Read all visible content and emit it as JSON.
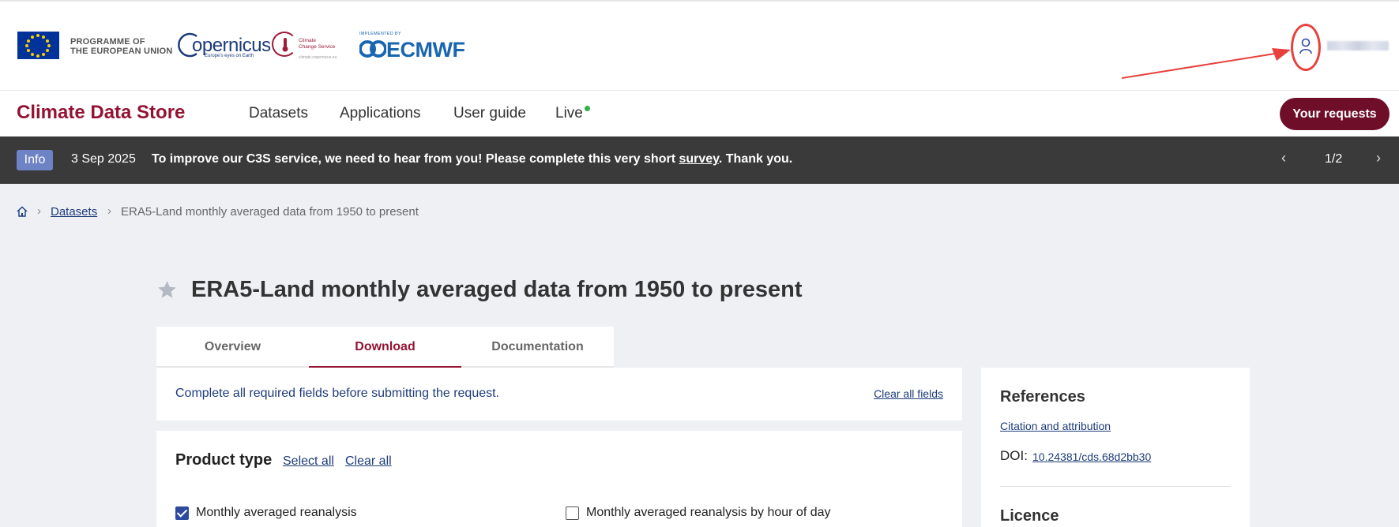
{
  "header": {
    "programme_text_line1": "PROGRAMME OF",
    "programme_text_line2": "THE EUROPEAN UNION",
    "copernicus_word": "opernicus",
    "copernicus_tagline": "Europe's eyes on Earth",
    "c3s_line1": "Climate",
    "c3s_line2": "Change Service",
    "c3s_url": "climate.copernicus.eu",
    "ecmwf_small": "IMPLEMENTED BY",
    "ecmwf_big": "ECMWF"
  },
  "nav": {
    "brand": "Climate Data Store",
    "items": [
      {
        "label": "Datasets"
      },
      {
        "label": "Applications"
      },
      {
        "label": "User guide"
      },
      {
        "label": "Live"
      }
    ],
    "requests_button": "Your requests"
  },
  "banner": {
    "badge": "Info",
    "date": "3 Sep 2025",
    "message_before": "To improve our C3S service, we need to hear from you! Please complete this very short ",
    "message_link": "survey",
    "message_after": ". Thank you.",
    "prev": "‹",
    "count": "1/2",
    "next": "›"
  },
  "breadcrumb": {
    "sep": "›",
    "datasets": "Datasets",
    "current": "ERA5-Land monthly averaged data from 1950 to present"
  },
  "page": {
    "title": "ERA5-Land monthly averaged data from 1950 to present"
  },
  "tabs": [
    {
      "label": "Overview"
    },
    {
      "label": "Download"
    },
    {
      "label": "Documentation"
    }
  ],
  "notice": {
    "text": "Complete all required fields before submitting the request.",
    "clear_fields": "Clear all fields"
  },
  "product_type": {
    "title": "Product type",
    "select_all": "Select all",
    "clear_all": "Clear all",
    "options": [
      {
        "label": "Monthly averaged reanalysis",
        "checked": true
      },
      {
        "label": "Monthly averaged reanalysis by hour of day",
        "checked": false
      }
    ]
  },
  "sidebar": {
    "references_title": "References",
    "citation_link": "Citation and attribution",
    "doi_label": "DOI:",
    "doi_value": "10.24381/cds.68d2bb30",
    "licence_title": "Licence"
  },
  "colors": {
    "brand": "#941333",
    "requests_button": "#6e0e29",
    "banner_bg": "#3a3a3a",
    "info_badge": "#6d83c5",
    "link": "#1d3c7a",
    "live_dot": "#2db34a",
    "annotation": "#e8413d"
  }
}
